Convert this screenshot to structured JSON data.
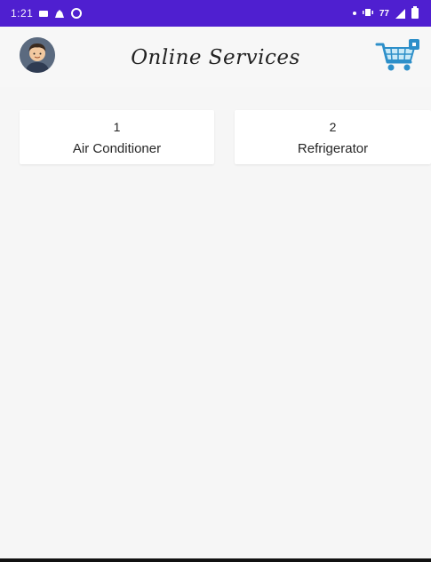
{
  "status_bar": {
    "time": "1:21",
    "extra": "77",
    "bg_color": "#4f1fd0"
  },
  "header": {
    "title": "Online Services",
    "avatar_icon": "user-avatar-icon",
    "cart_icon": "shopping-cart-icon"
  },
  "services": [
    {
      "number": "1",
      "label": "Air Conditioner"
    },
    {
      "number": "2",
      "label": "Refrigerator"
    }
  ]
}
